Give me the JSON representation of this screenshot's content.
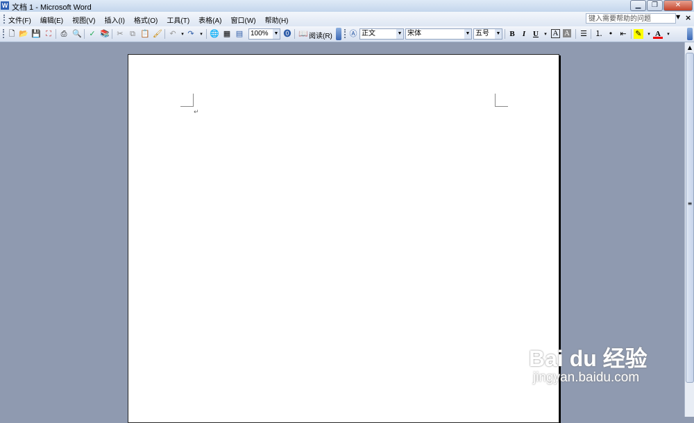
{
  "window": {
    "title": "文档 1 - Microsoft Word",
    "app_icon": "W"
  },
  "menu": {
    "items": [
      "文件(F)",
      "编辑(E)",
      "视图(V)",
      "插入(I)",
      "格式(O)",
      "工具(T)",
      "表格(A)",
      "窗口(W)",
      "帮助(H)"
    ],
    "help_placeholder": "键入需要帮助的问题"
  },
  "toolbar": {
    "zoom": "100%",
    "read_label": "阅读(R)",
    "style": "正文",
    "font": "宋体",
    "size": "五号",
    "bold": "B",
    "italic": "I",
    "underline": "U",
    "char_border": "A",
    "char_shade": "A"
  },
  "document": {
    "paragraph_mark": "↵"
  },
  "watermark": {
    "brand": "Bai du 经验",
    "url": "jingyan.baidu.com"
  }
}
